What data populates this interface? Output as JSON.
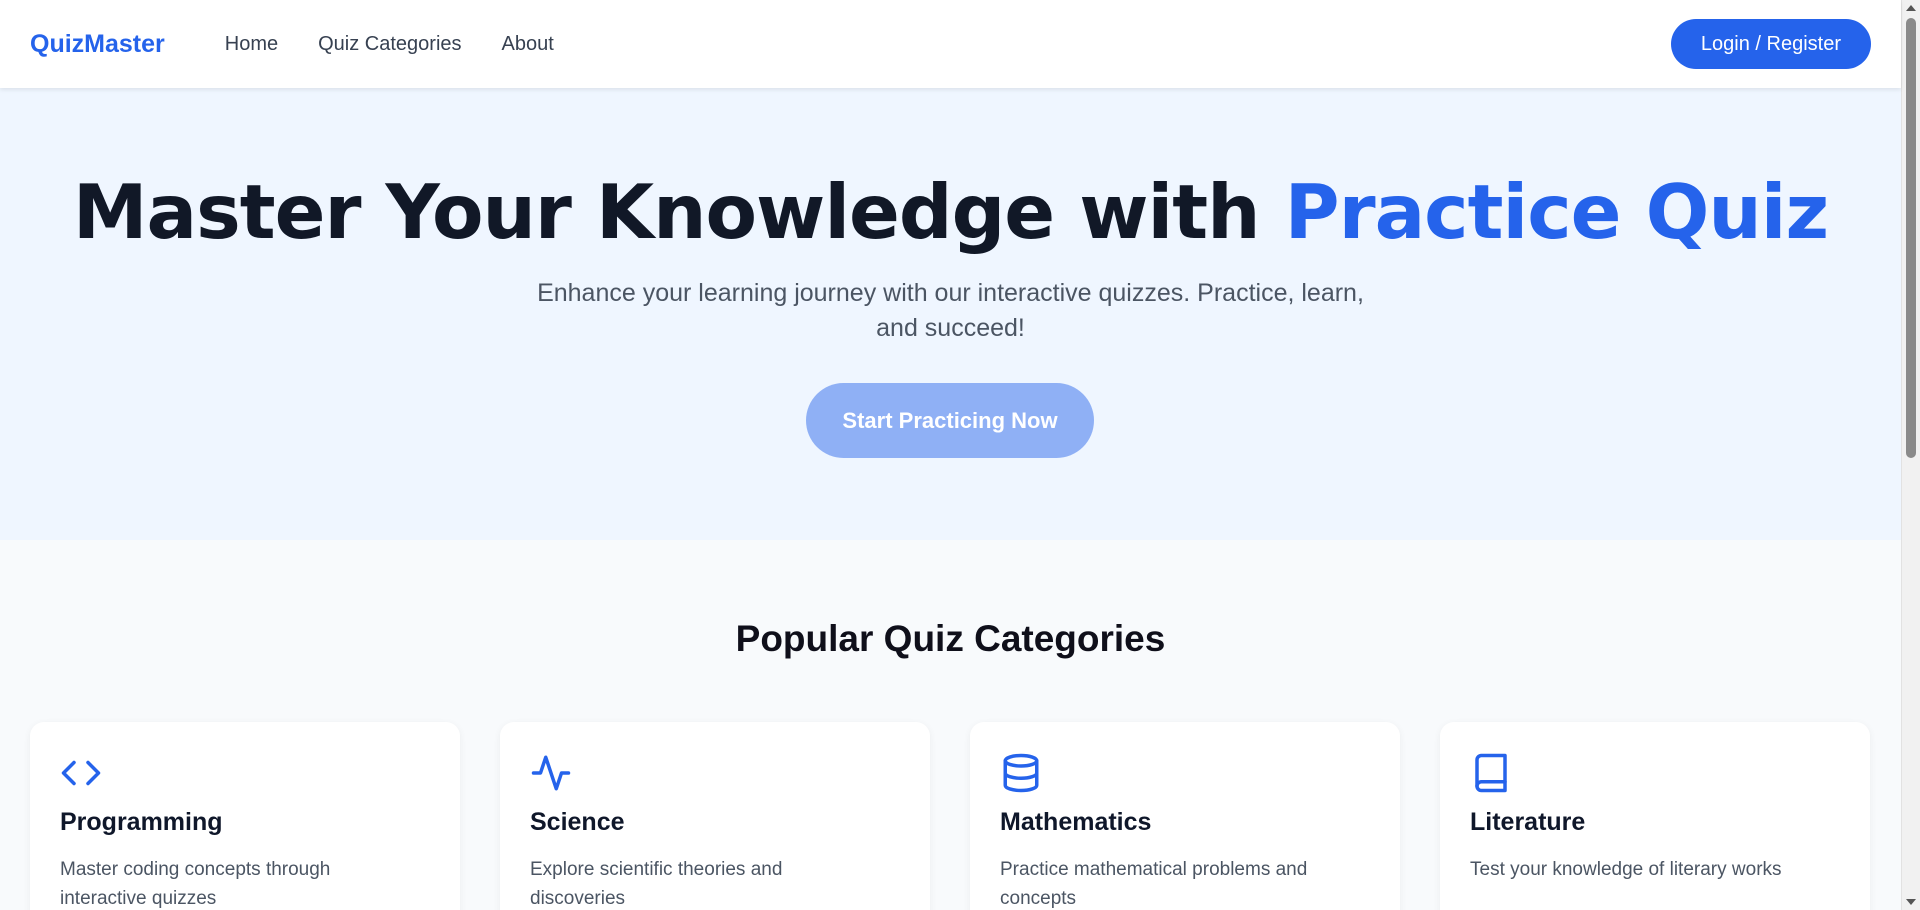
{
  "nav": {
    "brand": "QuizMaster",
    "links": [
      "Home",
      "Quiz Categories",
      "About"
    ],
    "login_label": "Login / Register"
  },
  "hero": {
    "title_main": "Master Your Knowledge with ",
    "title_accent": "Practice Quiz",
    "subtitle": "Enhance your learning journey with our interactive quizzes. Practice, learn, and succeed!",
    "cta_label": "Start Practicing Now"
  },
  "categories": {
    "title": "Popular Quiz Categories",
    "items": [
      {
        "icon": "code-icon",
        "title": "Programming",
        "description": "Master coding concepts through interactive quizzes"
      },
      {
        "icon": "activity-icon",
        "title": "Science",
        "description": "Explore scientific theories and discoveries"
      },
      {
        "icon": "database-icon",
        "title": "Mathematics",
        "description": "Practice mathematical problems and concepts"
      },
      {
        "icon": "book-icon",
        "title": "Literature",
        "description": "Test your knowledge of literary works"
      }
    ]
  },
  "colors": {
    "brand": "#2563eb",
    "cta_button": "#8fb0f5",
    "hero_background": "#eff6ff",
    "heading": "#111827",
    "body_text": "#4b5563"
  }
}
